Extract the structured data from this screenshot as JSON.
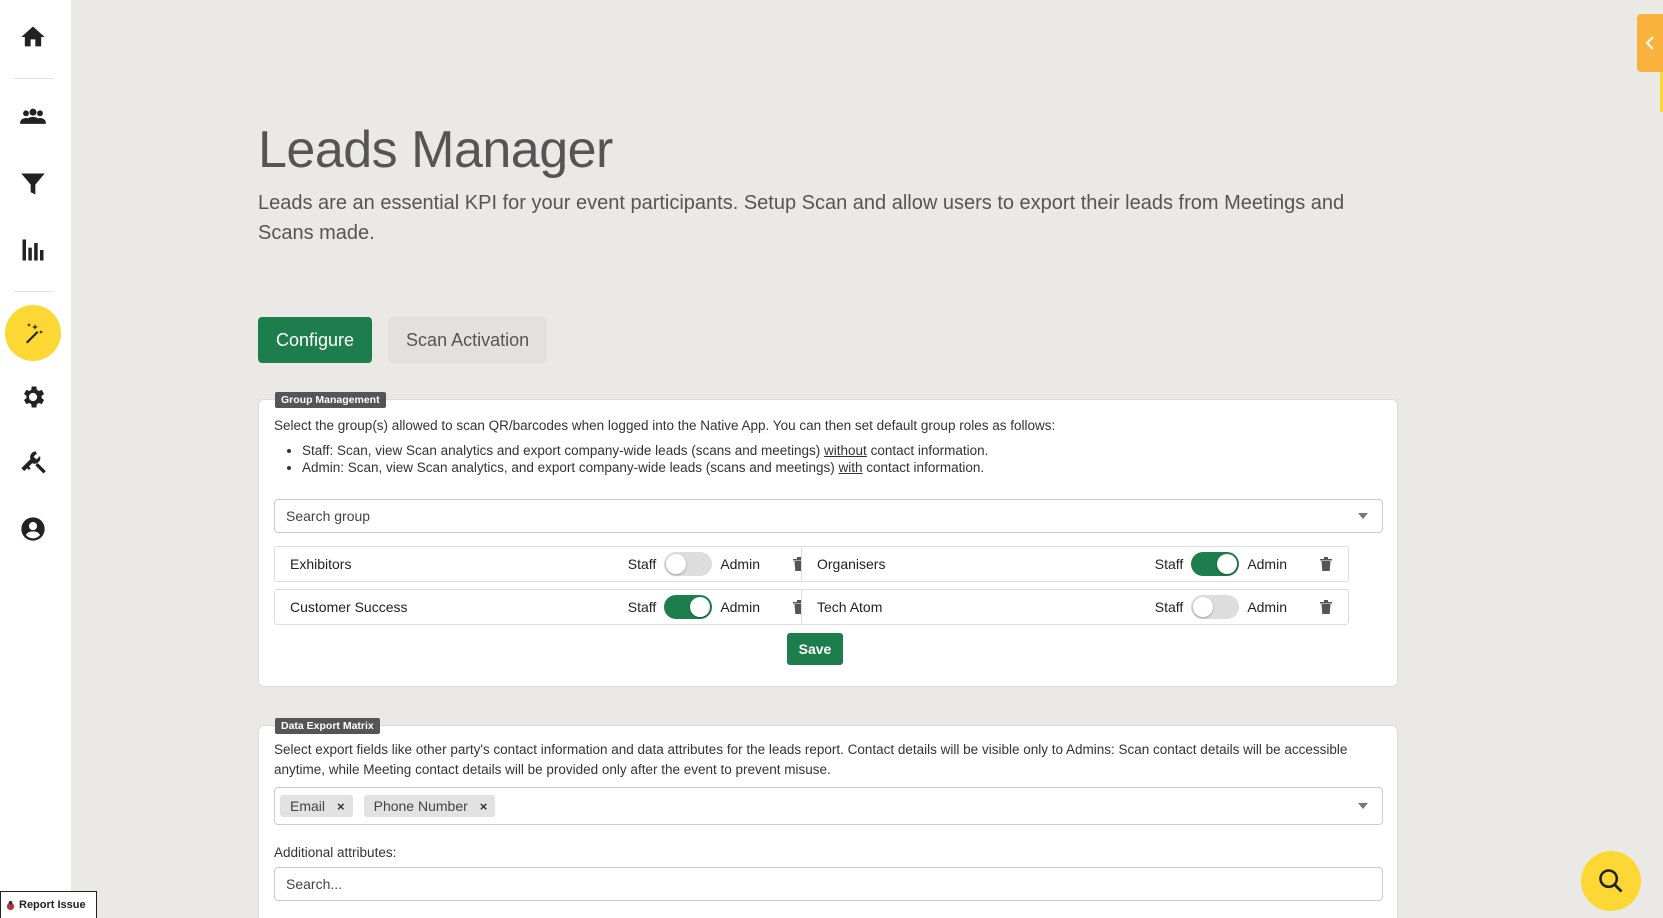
{
  "sidebar": {
    "items": [
      {
        "name": "home-icon"
      },
      {
        "name": "people-icon"
      },
      {
        "name": "filter-icon"
      },
      {
        "name": "bar-chart-icon"
      },
      {
        "name": "magic-wand-icon",
        "active": true
      },
      {
        "name": "gear-icon"
      },
      {
        "name": "tools-icon"
      },
      {
        "name": "account-icon"
      }
    ]
  },
  "page": {
    "title": "Leads Manager",
    "description": "Leads are an essential KPI for your event participants. Setup Scan and allow users to export their leads from Meetings and Scans made."
  },
  "tabs": [
    {
      "label": "Configure",
      "active": true
    },
    {
      "label": "Scan Activation",
      "active": false
    }
  ],
  "group_management": {
    "legend": "Group Management",
    "intro": "Select the group(s) allowed to scan QR/barcodes when logged into the Native App. You can then set default group roles as follows:",
    "bullet_staff_pre": "Staff: Scan, view Scan analytics and export company-wide leads (scans and meetings) ",
    "bullet_staff_u": "without",
    "bullet_staff_post": " contact information.",
    "bullet_admin_pre": "Admin: Scan, view Scan analytics, and export company-wide leads (scans and meetings) ",
    "bullet_admin_u": "with",
    "bullet_admin_post": " contact information.",
    "search_placeholder": "Search group",
    "staff_label": "Staff",
    "admin_label": "Admin",
    "groups": [
      {
        "name": "Exhibitors",
        "admin": false
      },
      {
        "name": "Organisers",
        "admin": true
      },
      {
        "name": "Customer Success",
        "admin": true
      },
      {
        "name": "Tech Atom",
        "admin": false
      }
    ],
    "save_label": "Save"
  },
  "data_export": {
    "legend": "Data Export Matrix",
    "intro": "Select export fields like other party's contact information and data attributes for the leads report. Contact details will be visible only to Admins: Scan contact details will be accessible anytime, while Meeting contact details will be provided only after the event to prevent misuse.",
    "chips": [
      "Email",
      "Phone Number"
    ],
    "additional_label": "Additional attributes:",
    "search_placeholder": "Search..."
  },
  "report_issue": "Report Issue",
  "colors": {
    "accent": "#1e7d4c",
    "highlight": "#fdd835",
    "handle": "#f9b33d"
  }
}
